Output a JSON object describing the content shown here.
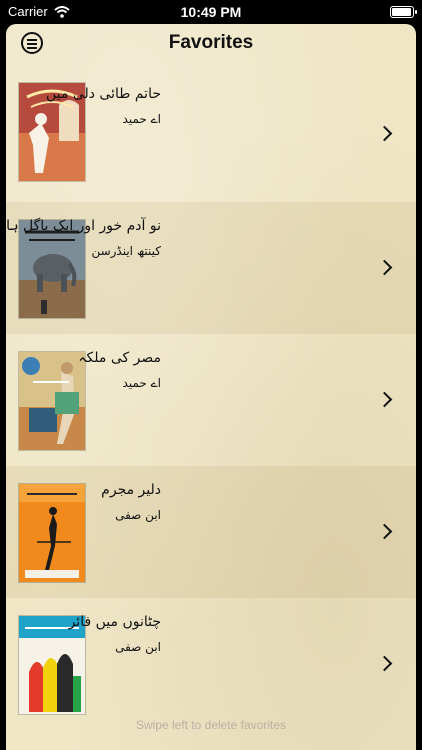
{
  "status_bar": {
    "carrier": "Carrier",
    "time": "10:49 PM",
    "battery_level": 1.0
  },
  "header": {
    "title": "Favorites"
  },
  "favorites": [
    {
      "title": "حاتم طائی دلی میں",
      "author": "اے حمید"
    },
    {
      "title": "نو آدم خور اور ایک پاگل ہاتھی",
      "author": "کینتھ اینڈرسن"
    },
    {
      "title": "مصر کی ملکہ",
      "author": "اے حمید"
    },
    {
      "title": "دلیر مجرم",
      "author": "ابن صفی"
    },
    {
      "title": "چٹانوں میں فائر",
      "author": "ابن صفی"
    }
  ],
  "footer": {
    "hint": "Swipe left to delete favorites"
  }
}
